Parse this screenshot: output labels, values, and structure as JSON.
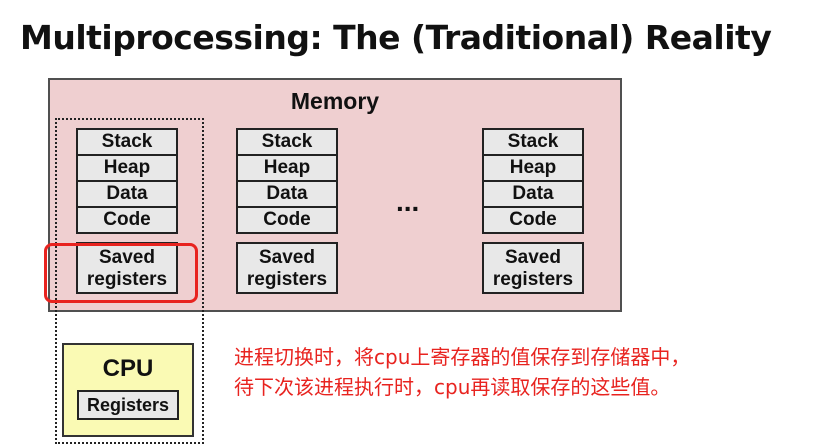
{
  "title": "Multiprocessing: The (Traditional) Reality",
  "memory": {
    "label": "Memory"
  },
  "processes": [
    {
      "segments": [
        "Stack",
        "Heap",
        "Data",
        "Code"
      ],
      "saved": [
        "Saved",
        "registers"
      ]
    },
    {
      "segments": [
        "Stack",
        "Heap",
        "Data",
        "Code"
      ],
      "saved": [
        "Saved",
        "registers"
      ]
    },
    {
      "segments": [
        "Stack",
        "Heap",
        "Data",
        "Code"
      ],
      "saved": [
        "Saved",
        "registers"
      ]
    }
  ],
  "ellipsis": "...",
  "cpu": {
    "label": "CPU",
    "registers": "Registers"
  },
  "annotation": [
    "进程切换时，将cpu上寄存器的值保存到存储器中，",
    "待下次该进程执行时，cpu再读取保存的这些值。"
  ],
  "colors": {
    "memory_bg": "#efcfd0",
    "cpu_bg": "#fafab4",
    "highlight": "#e8231f",
    "annotation": "#e8231f"
  }
}
